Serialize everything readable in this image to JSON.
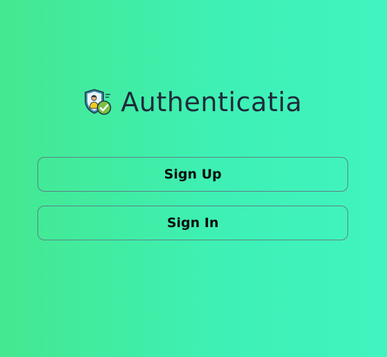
{
  "app": {
    "title": "Authenticatia",
    "logo_icon": "shield-user-check-icon"
  },
  "actions": {
    "sign_up_label": "Sign Up",
    "sign_in_label": "Sign In"
  },
  "colors": {
    "background_start": "#44e88f",
    "background_end": "#40f4c0",
    "title_text": "#1f2b3a",
    "button_border": "#5f7f86",
    "button_text": "#0b0d0e"
  }
}
